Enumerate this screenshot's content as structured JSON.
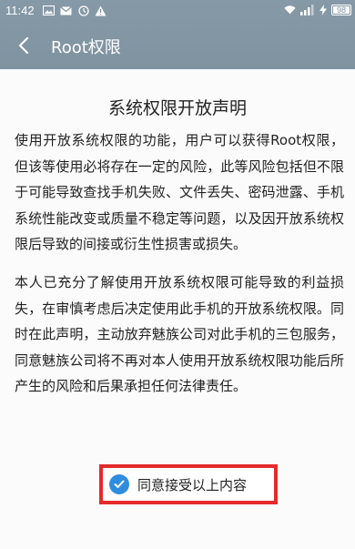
{
  "status_bar": {
    "time": "11:42",
    "battery_level": "98",
    "icons": [
      "image-icon",
      "email-icon",
      "clock-icon",
      "warning-icon",
      "wifi-icon",
      "signal-icon",
      "bolt-icon",
      "battery-icon"
    ]
  },
  "nav": {
    "back_icon": "chevron-left-icon",
    "title": "Root权限"
  },
  "document": {
    "title": "系统权限开放声明",
    "paragraph_1": "使用开放系统权限的功能，用户可以获得Root权限，但该等使用必将存在一定的风险，此等风险包括但不限于可能导致查找手机失败、文件丢失、密码泄露、手机系统性能改变或质量不稳定等问题，以及因开放系统权限后导致的间接或衍生性损害或损失。",
    "paragraph_2": "本人已充分了解使用开放系统权限可能导致的利益损失，在审慎考虑后决定使用此手机的开放系统权限。同时在此声明，主动放弃魅族公司对此手机的三包服务，同意魅族公司将不再对本人使用开放系统权限功能后所产生的风险和后果承担任何法律责任。"
  },
  "agreement": {
    "checked": true,
    "label": "同意接受以上内容",
    "highlight_color": "#e42a2a",
    "check_color": "#2f8de0"
  },
  "colors": {
    "header": "#8296a3",
    "background": "#fbfbfb",
    "text": "#222222"
  }
}
